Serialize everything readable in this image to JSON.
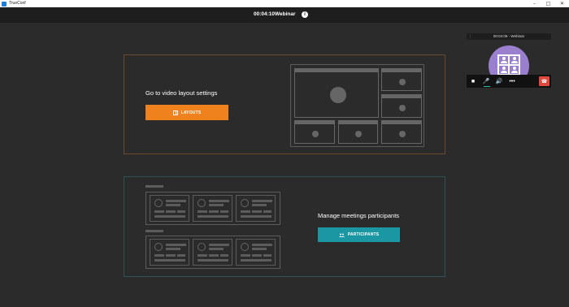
{
  "window": {
    "title": "TrueConf",
    "controls": [
      "–",
      "□",
      "✕"
    ]
  },
  "header": {
    "timer": "00:04:10",
    "conference_name": "Webinar",
    "info_glyph": "i"
  },
  "layouts_panel": {
    "label": "Go to video layout settings",
    "button_label": "LAYOUTS",
    "button_color": "#f0821e",
    "icon": "layout-grid-icon"
  },
  "participants_panel": {
    "label": "Manage meetings participants",
    "button_label": "PARTICIPANTS",
    "button_color": "#1b96a3",
    "icon": "people-icon"
  },
  "mini_window": {
    "title": "00:04:06 - Webinar",
    "menu_glyph": "⋮",
    "avatar_color": "#9b7fcf",
    "toolbar": {
      "camera": "■",
      "mic": "🎤",
      "speaker": "🔊",
      "more": "•••",
      "hangup": "☎"
    }
  }
}
